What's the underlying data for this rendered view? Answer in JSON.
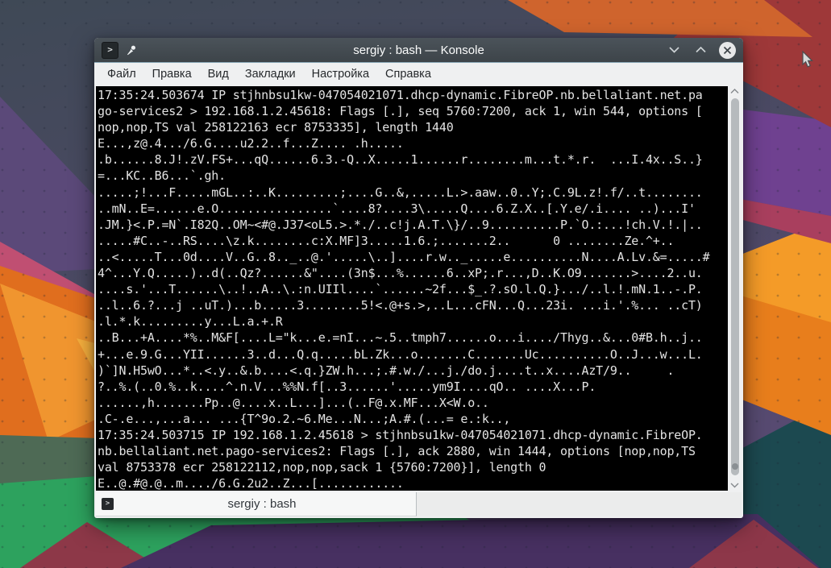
{
  "window": {
    "title": "sergiy : bash — Konsole",
    "controls": {
      "minimize": "chevron-down",
      "maximize": "chevron-up",
      "close": "circled-x"
    }
  },
  "menu": {
    "items": [
      {
        "label": "Файл"
      },
      {
        "label": "Правка"
      },
      {
        "label": "Вид"
      },
      {
        "label": "Закладки"
      },
      {
        "label": "Настройка"
      },
      {
        "label": "Справка"
      }
    ]
  },
  "terminal": {
    "prompt_icon": ">",
    "lines": [
      "17:35:24.503674 IP stjhnbsu1kw-047054021071.dhcp-dynamic.FibreOP.nb.bellaliant.net.pa",
      "go-services2 > 192.168.1.2.45618: Flags [.], seq 5760:7200, ack 1, win 544, options [",
      "nop,nop,TS val 258122163 ecr 8753335], length 1440",
      "E...,z@.4.../6.G....u2.2..f...Z.... .h.....",
      ".b......8.J!.zV.FS+...qQ......6.3.-Q..X.....1......r........m...t.*.r.  ...I.4x..S..}",
      "=...KC..B6...`.gh.",
      ".....;!...F.....mGL..:..K.........;....G..&,.....L.>.aaw..0..Y;.C.9L.z!.f/..t........",
      "..mN..E=......e.O................`....8?....3\\.....Q....6.Z.X..[.Y.e/.i.... ..)...I'",
      ".JM.}<.P.=N`.I82Q..OM~<#@.J37<oL5.>.*./..c!j.A.T.\\}/..9..........P.`O.:...!ch.V.!.|..",
      ".....#C..-..RS....\\z.k........c:X.MF]3.....1.6.;.......2..      0 ........Ze.^+..",
      "..<.....T...0d....V..G..8.._..@.'.....\\..]....r.w.._.....e..........N....A.Lv.&=.....#",
      "4^...Y.Q.....)..d(..Qz?......&\"....(3n$...%......6..xP;.r...,D..K.O9.......>....2..u.",
      "....s.'...T......\\..!..A..\\.:n.UIIl....`......~2f...$_.?.sO.l.Q.}.../..l.!.mN.1..-.P.",
      "..l..6.?...j ..uT.)...b.....3........5!<.@+s.>,..L...cFN...Q...23i. ...i.'.%... ..cT)",
      ".l.*.k.........y...L.a.+.R",
      "..B...+A....*%..M&F[....L=\"k...e.=nI...~.5..tmph7......o...i..../Thyg..&...0#B.h..j..",
      "+...e.9.G...YII......3..d...Q.q.....bL.Zk...o.......C.......Uc..........O..J...w...L.",
      ")`]N.H5wO...*..<.y..&.b....<.q.}ZW.h...;.#.w./...j./do.j....t..x....AzT/9..     .",
      "?..%.(..0.%..k....^.n.V...%%N.f[..3......'.....ym9I....qO.. ....X...P.",
      "......,h.......Pp..@....x..L...]...(..F@.x.MF...X<W.o..",
      ".C-.e...,...a... ...{T^9o.2.~6.Me...N...;A.#.(...= e.:k..,",
      "17:35:24.503715 IP 192.168.1.2.45618 > stjhnbsu1kw-047054021071.dhcp-dynamic.FibreOP.",
      "nb.bellaliant.net.pago-services2: Flags [.], ack 2880, win 1444, options [nop,nop,TS",
      "val 8753378 ecr 258122112,nop,nop,sack 1 {5760:7200}], length 0",
      "E..@.#@.@..m..../6.G.2u2..Z...[............"
    ]
  },
  "tabbar": {
    "active_tab": "sergiy : bash"
  },
  "colors": {
    "titlebar": "#454d54",
    "titlebar_separator": "#87a5b5",
    "menubar_bg": "#eff0f1",
    "terminal_bg": "#000000",
    "terminal_fg": "#e3e3e3",
    "tab_bg": "#f6f7f7",
    "scroll_thumb": "#b6babd",
    "wallpaper_palette": [
      "#414b59",
      "#5b4979",
      "#c04f72",
      "#e8761d",
      "#f09530",
      "#4e6a55",
      "#2da25e",
      "#1c4950",
      "#e87e1c",
      "#6f4190",
      "#9e3839",
      "#473061",
      "#8d3848"
    ]
  }
}
